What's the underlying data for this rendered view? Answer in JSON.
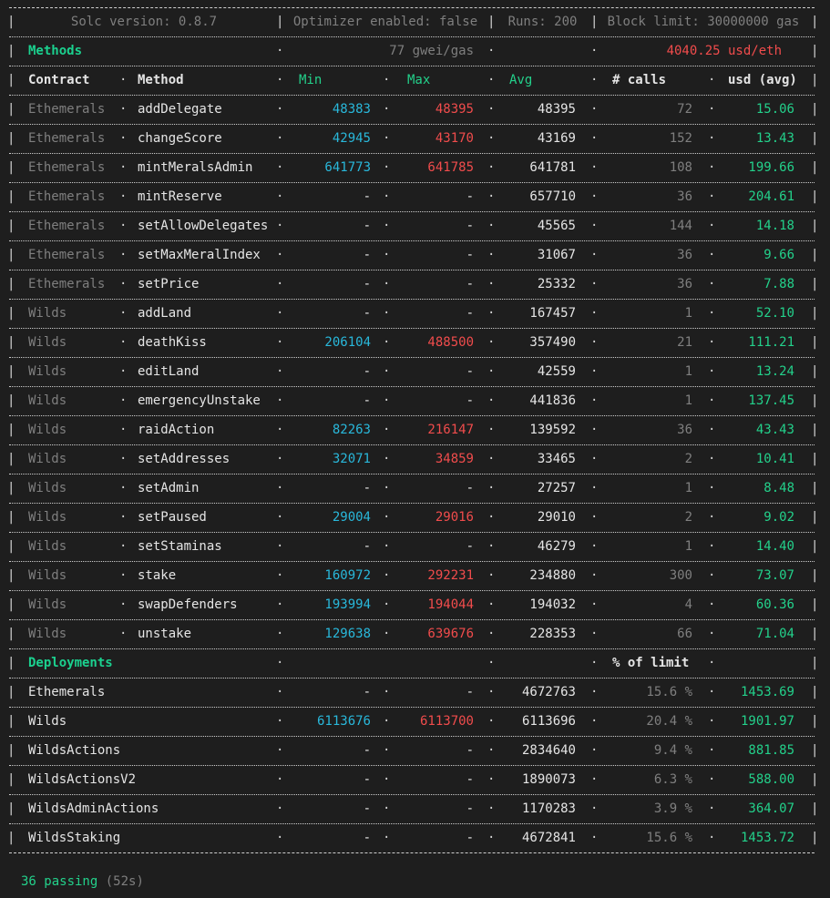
{
  "header": {
    "solc": "Solc version: 0.8.7",
    "optimizer": "Optimizer enabled: false",
    "runs": "Runs: 200",
    "block_limit": "Block limit: 30000000 gas"
  },
  "methods_section": {
    "title": "Methods",
    "gas_price": "77 gwei/gas",
    "eth_price": "4040.25 usd/eth"
  },
  "columns": {
    "contract": "Contract",
    "method": "Method",
    "min": "Min",
    "max": "Max",
    "avg": "Avg",
    "calls": "# calls",
    "usd": "usd (avg)"
  },
  "methods": [
    {
      "contract": "Ethemerals",
      "method": "addDelegate",
      "min": "48383",
      "max": "48395",
      "avg": "48395",
      "calls": "72",
      "usd": "15.06"
    },
    {
      "contract": "Ethemerals",
      "method": "changeScore",
      "min": "42945",
      "max": "43170",
      "avg": "43169",
      "calls": "152",
      "usd": "13.43"
    },
    {
      "contract": "Ethemerals",
      "method": "mintMeralsAdmin",
      "min": "641773",
      "max": "641785",
      "avg": "641781",
      "calls": "108",
      "usd": "199.66"
    },
    {
      "contract": "Ethemerals",
      "method": "mintReserve",
      "min": "-",
      "max": "-",
      "avg": "657710",
      "calls": "36",
      "usd": "204.61"
    },
    {
      "contract": "Ethemerals",
      "method": "setAllowDelegates",
      "min": "-",
      "max": "-",
      "avg": "45565",
      "calls": "144",
      "usd": "14.18"
    },
    {
      "contract": "Ethemerals",
      "method": "setMaxMeralIndex",
      "min": "-",
      "max": "-",
      "avg": "31067",
      "calls": "36",
      "usd": "9.66"
    },
    {
      "contract": "Ethemerals",
      "method": "setPrice",
      "min": "-",
      "max": "-",
      "avg": "25332",
      "calls": "36",
      "usd": "7.88"
    },
    {
      "contract": "Wilds",
      "method": "addLand",
      "min": "-",
      "max": "-",
      "avg": "167457",
      "calls": "1",
      "usd": "52.10"
    },
    {
      "contract": "Wilds",
      "method": "deathKiss",
      "min": "206104",
      "max": "488500",
      "avg": "357490",
      "calls": "21",
      "usd": "111.21"
    },
    {
      "contract": "Wilds",
      "method": "editLand",
      "min": "-",
      "max": "-",
      "avg": "42559",
      "calls": "1",
      "usd": "13.24"
    },
    {
      "contract": "Wilds",
      "method": "emergencyUnstake",
      "min": "-",
      "max": "-",
      "avg": "441836",
      "calls": "1",
      "usd": "137.45"
    },
    {
      "contract": "Wilds",
      "method": "raidAction",
      "min": "82263",
      "max": "216147",
      "avg": "139592",
      "calls": "36",
      "usd": "43.43"
    },
    {
      "contract": "Wilds",
      "method": "setAddresses",
      "min": "32071",
      "max": "34859",
      "avg": "33465",
      "calls": "2",
      "usd": "10.41"
    },
    {
      "contract": "Wilds",
      "method": "setAdmin",
      "min": "-",
      "max": "-",
      "avg": "27257",
      "calls": "1",
      "usd": "8.48"
    },
    {
      "contract": "Wilds",
      "method": "setPaused",
      "min": "29004",
      "max": "29016",
      "avg": "29010",
      "calls": "2",
      "usd": "9.02"
    },
    {
      "contract": "Wilds",
      "method": "setStaminas",
      "min": "-",
      "max": "-",
      "avg": "46279",
      "calls": "1",
      "usd": "14.40"
    },
    {
      "contract": "Wilds",
      "method": "stake",
      "min": "160972",
      "max": "292231",
      "avg": "234880",
      "calls": "300",
      "usd": "73.07"
    },
    {
      "contract": "Wilds",
      "method": "swapDefenders",
      "min": "193994",
      "max": "194044",
      "avg": "194032",
      "calls": "4",
      "usd": "60.36"
    },
    {
      "contract": "Wilds",
      "method": "unstake",
      "min": "129638",
      "max": "639676",
      "avg": "228353",
      "calls": "66",
      "usd": "71.04"
    }
  ],
  "deployments_section": {
    "title": "Deployments",
    "limit_label": "% of limit"
  },
  "deployments": [
    {
      "name": "Ethemerals",
      "min": "-",
      "max": "-",
      "avg": "4672763",
      "pct": "15.6 %",
      "usd": "1453.69"
    },
    {
      "name": "Wilds",
      "min": "6113676",
      "max": "6113700",
      "avg": "6113696",
      "pct": "20.4 %",
      "usd": "1901.97"
    },
    {
      "name": "WildsActions",
      "min": "-",
      "max": "-",
      "avg": "2834640",
      "pct": "9.4 %",
      "usd": "881.85"
    },
    {
      "name": "WildsActionsV2",
      "min": "-",
      "max": "-",
      "avg": "1890073",
      "pct": "6.3 %",
      "usd": "588.00"
    },
    {
      "name": "WildsAdminActions",
      "min": "-",
      "max": "-",
      "avg": "1170283",
      "pct": "3.9 %",
      "usd": "364.07"
    },
    {
      "name": "WildsStaking",
      "min": "-",
      "max": "-",
      "avg": "4672841",
      "pct": "15.6 %",
      "usd": "1453.72"
    }
  ],
  "footer": {
    "passing": "36 passing",
    "duration": "(52s)"
  },
  "colors": {
    "background": "#1e1e1e",
    "green": "#23d18b",
    "cyan": "#29b8db",
    "red": "#f14c4c",
    "gray": "#7f7f7f"
  }
}
